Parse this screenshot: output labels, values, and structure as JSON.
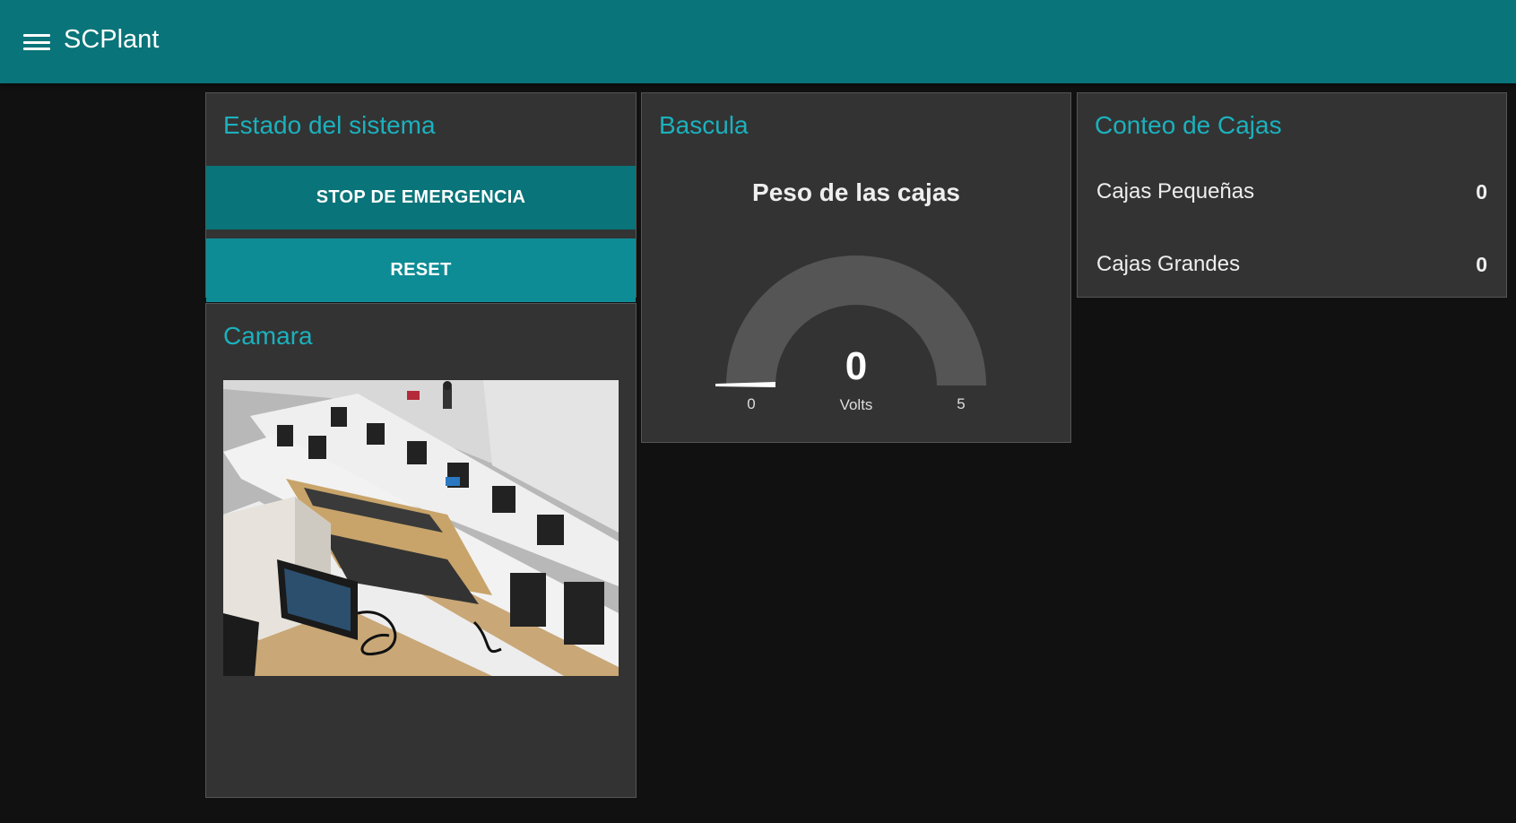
{
  "app": {
    "title": "SCPlant"
  },
  "header": {
    "menu_icon": "hamburger-menu-icon"
  },
  "colors": {
    "accent": "#097479",
    "accent_light": "#0e8c95",
    "title_text": "#1bb1bd",
    "card_bg": "#333333",
    "page_bg": "#111111"
  },
  "estado": {
    "title": "Estado del sistema",
    "stop_label": "STOP DE EMERGENCIA",
    "reset_label": "RESET"
  },
  "camara": {
    "title": "Camara"
  },
  "bascula": {
    "title": "Bascula",
    "gauge_label": "Peso de las cajas",
    "value": 0,
    "value_text": "0",
    "units": "Volts",
    "min": 0,
    "max": 5,
    "min_text": "0",
    "max_text": "5"
  },
  "conteo": {
    "title": "Conteo de Cajas",
    "rows": [
      {
        "label": "Cajas Pequeñas",
        "value": "0"
      },
      {
        "label": "Cajas Grandes",
        "value": "0"
      }
    ]
  }
}
